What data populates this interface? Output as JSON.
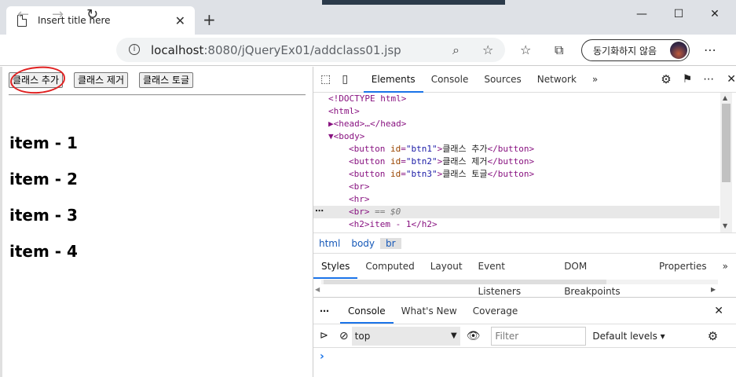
{
  "browser": {
    "tab_title": "Insert title here",
    "tab_close": "✕",
    "new_tab": "+",
    "url_host": "localhost",
    "url_path": ":8080/jQueryEx01/addclass01.jsp",
    "sync_label": "동기화하지 않음",
    "more": "⋯",
    "win_min": "—",
    "win_max": "☐",
    "win_close": "✕"
  },
  "page": {
    "buttons": [
      "클래스 추가",
      "클래스 제거",
      "클래스 토글"
    ],
    "items": [
      "item - 1",
      "item - 2",
      "item - 3",
      "item - 4"
    ],
    "annotation_color": "#e02020"
  },
  "devtools": {
    "tabs": [
      "Elements",
      "Console",
      "Sources",
      "Network"
    ],
    "more_tabs": "»",
    "active_tab": "Elements",
    "dom_lines": [
      {
        "text": "<!DOCTYPE html>"
      },
      {
        "text": "<html>"
      },
      {
        "text": "▶<head>…</head>"
      },
      {
        "text": "▼<body>"
      },
      {
        "tag": "button",
        "id": "btn1",
        "content": "클래스 추가"
      },
      {
        "tag": "button",
        "id": "btn2",
        "content": "클래스 제거"
      },
      {
        "tag": "button",
        "id": "btn3",
        "content": "클래스 토글"
      },
      {
        "text": "<br>"
      },
      {
        "text": "<hr>"
      },
      {
        "text": "<br>",
        "suffix": " == $0"
      },
      {
        "text": "<h2>item - 1</h2>"
      }
    ],
    "breadcrumbs": [
      "html",
      "body",
      "br"
    ],
    "style_tabs": [
      "Styles",
      "Computed",
      "Layout",
      "Event Listeners",
      "DOM Breakpoints",
      "Properties"
    ],
    "drawer_tabs": [
      "Console",
      "What's New",
      "Coverage"
    ],
    "context": "top",
    "filter_placeholder": "Filter",
    "levels": "Default levels ▾",
    "prompt": "›",
    "ellipsis": "⋯",
    "close": "✕",
    "accent": "#1a73e8"
  }
}
